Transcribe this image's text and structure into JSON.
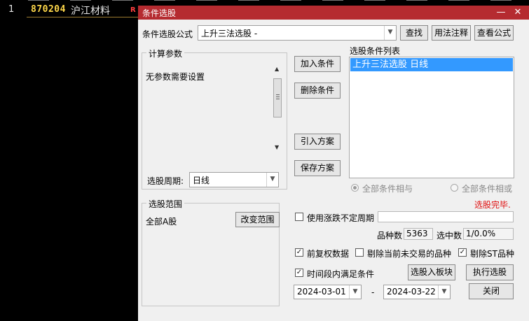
{
  "background_row": {
    "index": "1",
    "code": "870204",
    "name": "沪江材料",
    "flag": "R"
  },
  "dialog": {
    "title": "条件选股",
    "formula_label": "条件选股公式",
    "formula_value": "上升三法选股 -",
    "find_button": "查找",
    "usage_button": "用法注释",
    "view_formula_button": "查看公式",
    "params_group": "计算参数",
    "params_text": "无参数需要设置",
    "period_label": "选股周期:",
    "period_value": "日线",
    "add_condition_button": "加入条件",
    "delete_condition_button": "删除条件",
    "import_plan_button": "引入方案",
    "save_plan_button": "保存方案",
    "condition_list_label": "选股条件列表",
    "condition_items": [
      "上升三法选股  日线"
    ],
    "radio_and": "全部条件相与",
    "radio_or": "全部条件相或",
    "status_text": "选股完毕.",
    "status_color": "#e01010",
    "range_group": "选股范围",
    "range_value": "全部A股",
    "change_range_button": "改变范围",
    "uncertain_period_label": "使用涨跌不定周期",
    "variety_count_label": "品种数",
    "variety_count_value": "5363",
    "selected_count_label": "选中数",
    "selected_count_value": "1/0.0%",
    "adjusted_data_label": "前复权数据",
    "exclude_untraded_label": "剔除当前未交易的品种",
    "exclude_st_label": "剔除ST品种",
    "time_range_label": "时间段内满足条件",
    "to_block_button": "选股入板块",
    "execute_button": "执行选股",
    "close_button": "关闭",
    "start_date": "2024-03-01",
    "date_separator": "-",
    "end_date": "2024-03-22",
    "check_mark": "✓",
    "minimize_symbol": "—",
    "close_symbol": "✕",
    "arrow_down": "▼",
    "arrow_up": "▲"
  },
  "colors": {
    "titlebar": "#b52b30",
    "selection": "#3399ff",
    "code_color": "#ffd84a"
  }
}
